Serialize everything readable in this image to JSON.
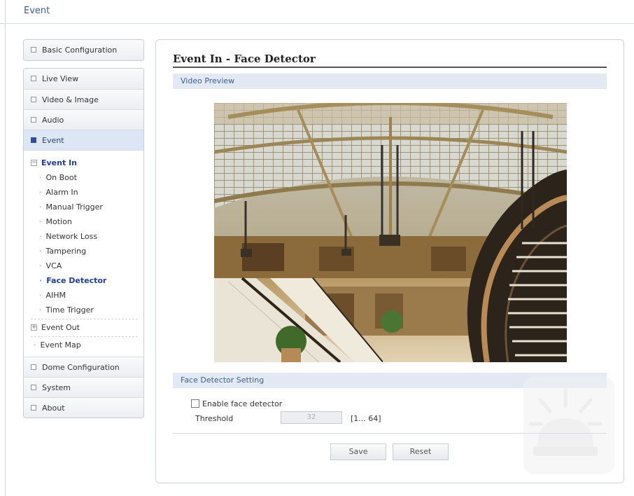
{
  "window": {
    "title": "Event"
  },
  "sidebar": {
    "top_item": "Basic Configuration",
    "items": [
      {
        "label": "Live View"
      },
      {
        "label": "Video & Image"
      },
      {
        "label": "Audio"
      },
      {
        "label": "Event",
        "active": true
      }
    ],
    "event_tree": {
      "root": "Event In",
      "children": [
        "On Boot",
        "Alarm In",
        "Manual Trigger",
        "Motion",
        "Network Loss",
        "Tampering",
        "VCA",
        "Face Detector",
        "AIHM",
        "Time Trigger"
      ],
      "active_child": "Face Detector",
      "event_out": "Event Out",
      "event_map": "Event Map"
    },
    "bottom_items": [
      {
        "label": "Dome Configuration"
      },
      {
        "label": "System"
      },
      {
        "label": "About"
      }
    ]
  },
  "main": {
    "title": "Event In - Face Detector",
    "preview_section": "Video Preview",
    "settings_section": "Face Detector Setting",
    "enable_label": "Enable face detector",
    "enable_checked": false,
    "threshold_label": "Threshold",
    "threshold_value": "32",
    "threshold_range": "[1... 64]",
    "save_label": "Save",
    "reset_label": "Reset"
  },
  "colors": {
    "accent": "#3a5f95",
    "active_nav": "#dde6f4",
    "section_bar": "#e3e9f3"
  },
  "icons": {
    "nav_bullet": "square-icon",
    "tree_expand": "plus-box-icon",
    "tree_collapse": "minus-box-icon",
    "decoration": "alarm-light-icon"
  }
}
